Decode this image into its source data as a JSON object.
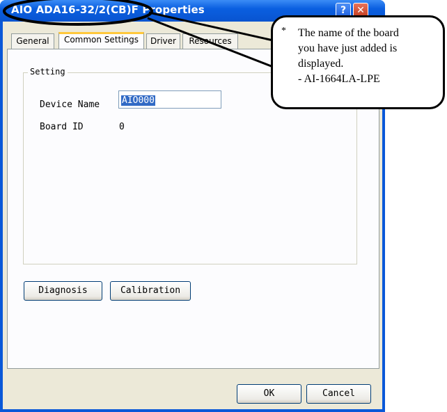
{
  "window": {
    "title": "AIO ADA16-32/2(CB)F Properties",
    "help_glyph": "?",
    "close_glyph": "✕"
  },
  "tabs": [
    {
      "label": "General",
      "active": false
    },
    {
      "label": "Common Settings",
      "active": true
    },
    {
      "label": "Driver",
      "active": false
    },
    {
      "label": "Resources",
      "active": false
    }
  ],
  "setting_group": {
    "label": "Setting",
    "device_name_label": "Device Name",
    "device_name_value": "AIO000",
    "board_id_label": "Board ID",
    "board_id_value": "0"
  },
  "action_buttons": {
    "diagnosis": "Diagnosis",
    "calibration": "Calibration"
  },
  "dialog_buttons": {
    "ok": "OK",
    "cancel": "Cancel"
  },
  "callout": {
    "marker": "*",
    "text_line1": "The name of the board",
    "text_line2": "you have just added is",
    "text_line3": "displayed.",
    "text_line4": "- AI-1664LA-LPE"
  }
}
